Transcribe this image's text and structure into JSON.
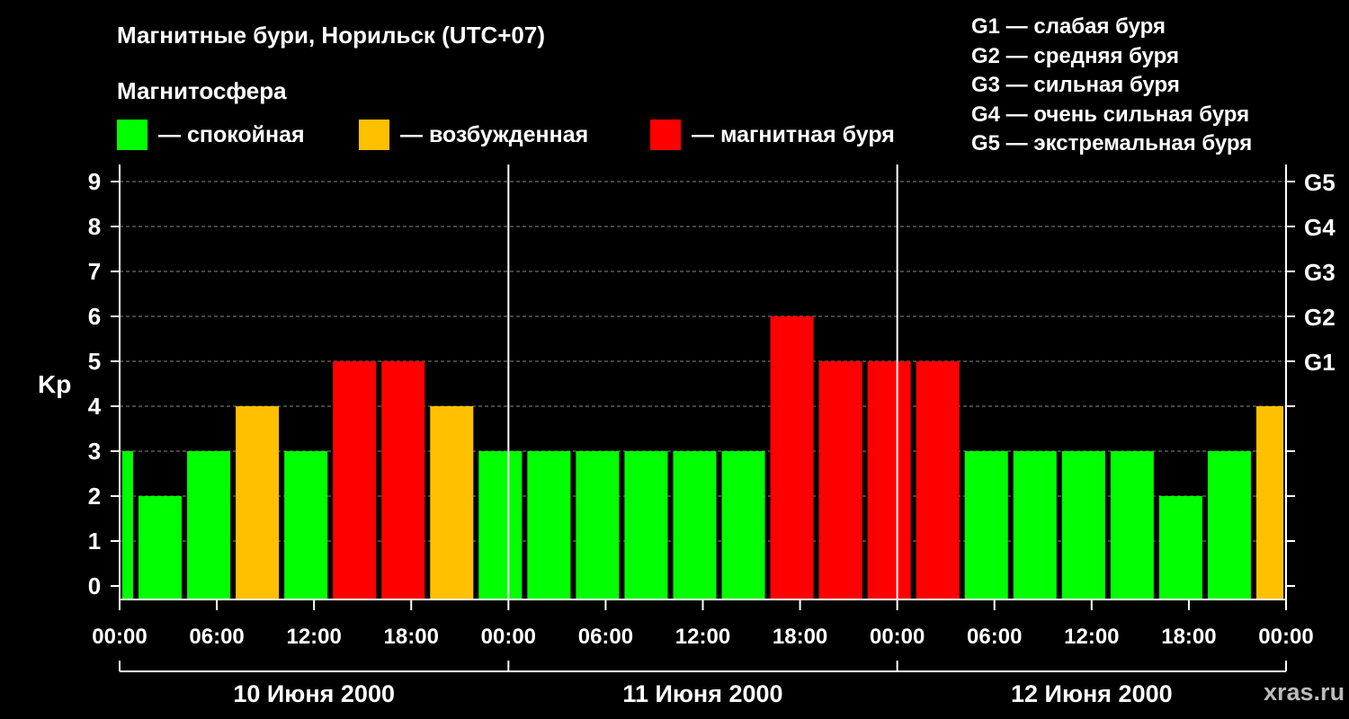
{
  "chart": {
    "title": "Магнитные бури, Норильск (UTC+07)",
    "subtitle": "Магнитосфера",
    "ylabel": "Kp",
    "watermark": "xras.ru",
    "legend": [
      {
        "label": "— спокойная",
        "color": "#00ff00"
      },
      {
        "label": "— возбужденная",
        "color": "#ffc000"
      },
      {
        "label": "— магнитная буря",
        "color": "#ff0000"
      }
    ],
    "storm_levels": [
      "G1 — слабая буря",
      "G2 — средняя буря",
      "G3 — сильная буря",
      "G4 — очень сильная буря",
      "G5 — экстремальная буря"
    ]
  },
  "chart_data": {
    "type": "bar",
    "title": "Магнитные бури, Норильск (UTC+07)",
    "ylabel": "Kp",
    "ylim": [
      0,
      9
    ],
    "yticks": [
      0,
      1,
      2,
      3,
      4,
      5,
      6,
      7,
      8,
      9
    ],
    "right_ticks": [
      {
        "value": 5,
        "label": "G1"
      },
      {
        "value": 6,
        "label": "G2"
      },
      {
        "value": 7,
        "label": "G3"
      },
      {
        "value": 8,
        "label": "G4"
      },
      {
        "value": 9,
        "label": "G5"
      }
    ],
    "xticks": [
      "00:00",
      "06:00",
      "12:00",
      "18:00",
      "00:00",
      "06:00",
      "12:00",
      "18:00",
      "00:00",
      "06:00",
      "12:00",
      "18:00",
      "00:00"
    ],
    "days": [
      "10 Июня 2000",
      "11 Июня 2000",
      "12 Июня 2000"
    ],
    "interval_hours": 3,
    "start_hour": -2,
    "values": [
      3,
      2,
      3,
      4,
      3,
      5,
      5,
      4,
      3,
      3,
      3,
      3,
      3,
      3,
      6,
      5,
      5,
      5,
      3,
      3,
      3,
      3,
      2,
      3,
      4
    ],
    "grid": true,
    "legend_position": "top",
    "colors": {
      "quiet": "#00ff00",
      "active": "#ffc000",
      "storm": "#ff0000"
    }
  }
}
